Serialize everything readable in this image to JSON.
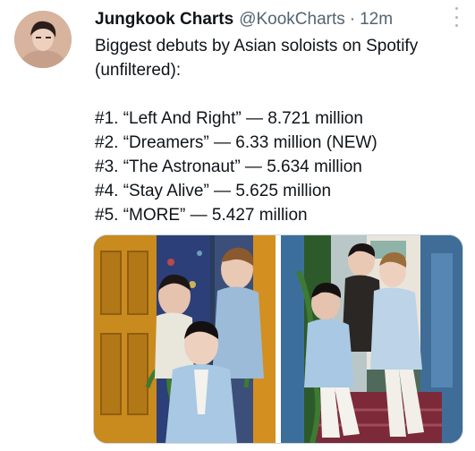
{
  "tweet": {
    "display_name": "Jungkook Charts",
    "handle": "@KookCharts",
    "separator": "·",
    "timestamp": "12m",
    "text_lines": [
      "Biggest debuts by Asian soloists on Spotify",
      "(unfiltered):",
      "",
      "#1. “Left And Right” — 8.721 million",
      "#2. “Dreamers” — 6.33 million (NEW)",
      "#3. “The Astronaut” — 5.634 million",
      "#4. “Stay Alive” — 5.625 million",
      "#5. “MORE” — 5.427 million"
    ],
    "icons": {
      "more": "more-vertical-icon"
    },
    "colors": {
      "text": "#0f1419",
      "secondary": "#536471",
      "border": "#cfd9de"
    }
  }
}
